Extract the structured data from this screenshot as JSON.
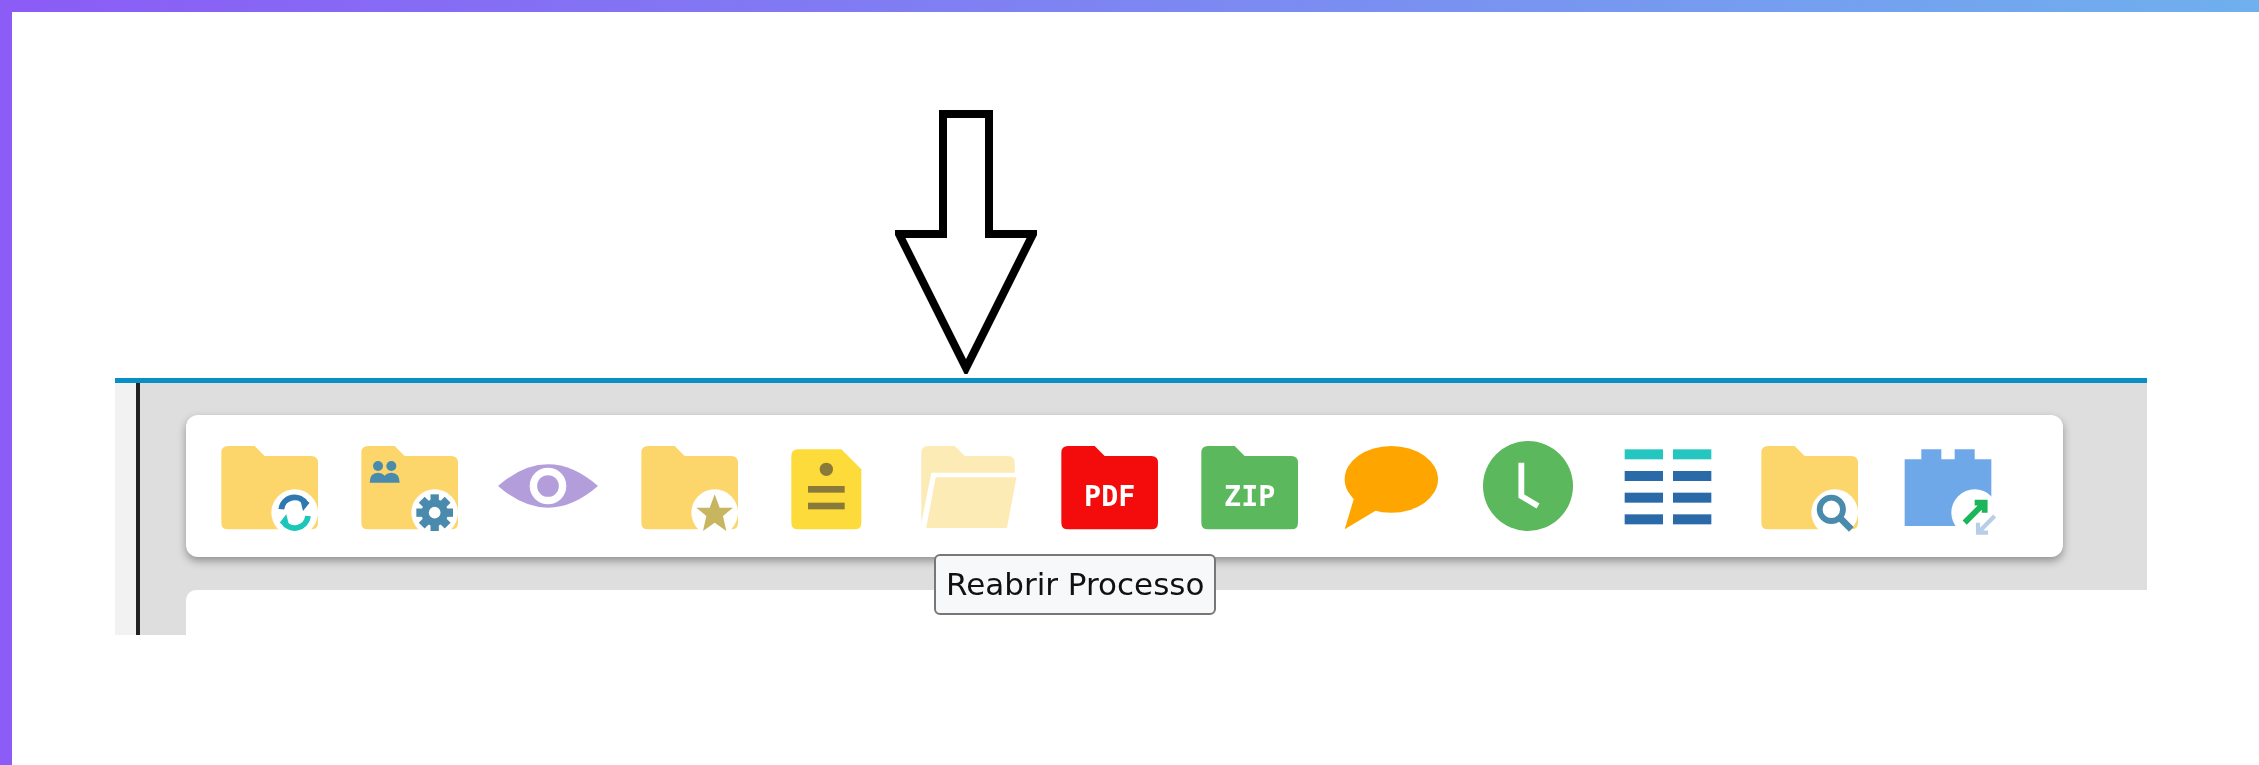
{
  "toolbar": {
    "buttons": [
      {
        "kind": "folder-sync"
      },
      {
        "kind": "folder-users-gear"
      },
      {
        "kind": "eye"
      },
      {
        "kind": "folder-star"
      },
      {
        "kind": "document"
      },
      {
        "kind": "folder-open",
        "tooltip": "Reabrir Processo"
      },
      {
        "kind": "pdf",
        "label": "PDF"
      },
      {
        "kind": "zip",
        "label": "ZIP"
      },
      {
        "kind": "chat"
      },
      {
        "kind": "clock"
      },
      {
        "kind": "list"
      },
      {
        "kind": "folder-search"
      },
      {
        "kind": "puzzle-arrows"
      }
    ]
  }
}
